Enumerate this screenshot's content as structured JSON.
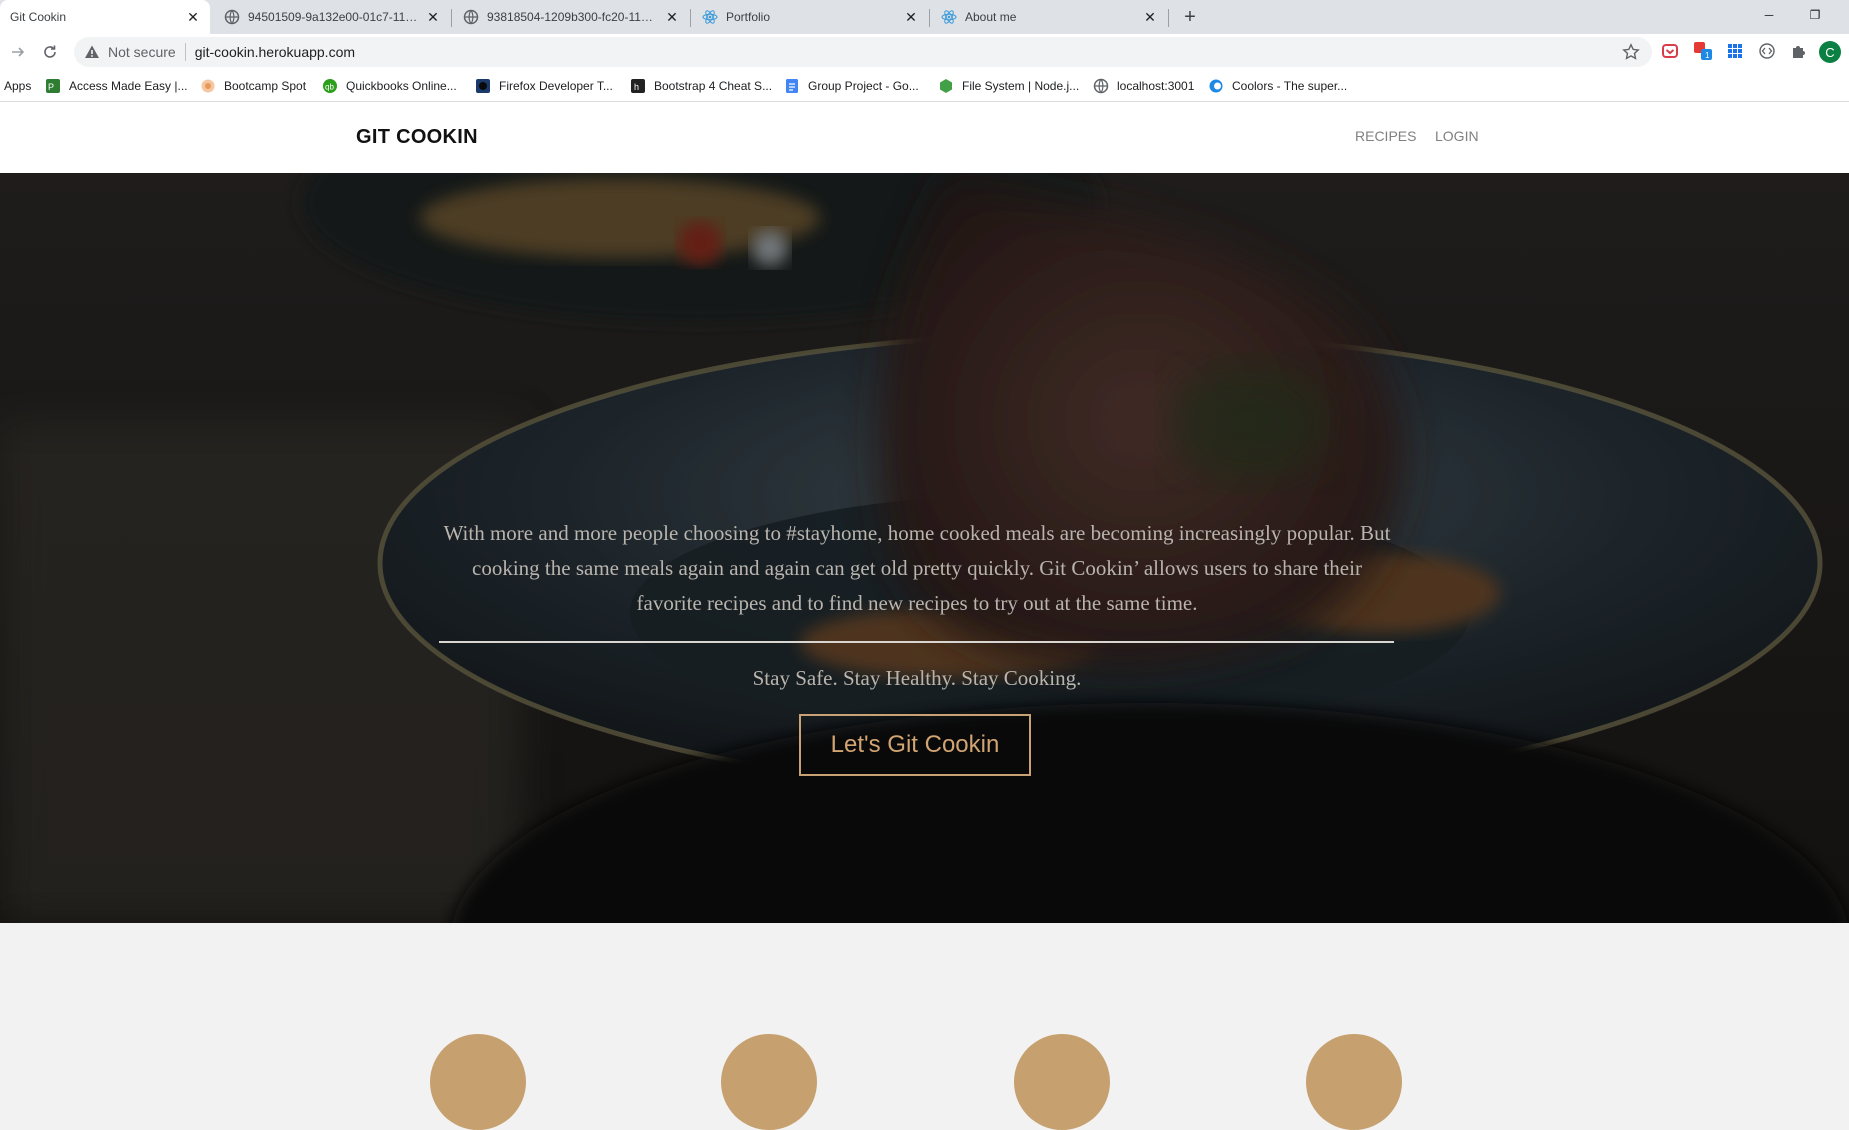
{
  "browser": {
    "tabs": [
      {
        "title": "Git Cookin",
        "icon": "page-icon",
        "active": true
      },
      {
        "title": "94501509-9a132e00-01c7-11eb-",
        "icon": "globe-icon",
        "active": false
      },
      {
        "title": "93818504-1209b300-fc20-11ea-",
        "icon": "globe-icon",
        "active": false
      },
      {
        "title": "Portfolio",
        "icon": "react-icon",
        "active": false
      },
      {
        "title": "About me",
        "icon": "react-icon",
        "active": false
      }
    ],
    "new_tab_glyph": "+",
    "window_controls": {
      "minimize": "─",
      "restore": "❐"
    },
    "security_label": "Not secure",
    "url": "git-cookin.herokuapp.com",
    "profile_initial": "C",
    "bookmarks": [
      {
        "label": "Apps",
        "icon": "apps-grid-icon"
      },
      {
        "label": "Access Made Easy |...",
        "icon": "access-icon"
      },
      {
        "label": "Bootcamp Spot",
        "icon": "bootcamp-icon"
      },
      {
        "label": "Quickbooks Online...",
        "icon": "quickbooks-icon"
      },
      {
        "label": "Firefox Developer T...",
        "icon": "firefox-icon"
      },
      {
        "label": "Bootstrap 4 Cheat S...",
        "icon": "hackerthemes-icon"
      },
      {
        "label": "Group Project - Go...",
        "icon": "google-docs-icon"
      },
      {
        "label": "File System | Node.j...",
        "icon": "nodejs-icon"
      },
      {
        "label": "localhost:3001",
        "icon": "globe-icon"
      },
      {
        "label": "Coolors - The super...",
        "icon": "coolors-icon"
      }
    ]
  },
  "site": {
    "brand": "GIT COOKIN",
    "nav": {
      "recipes": "RECIPES",
      "login": "LOGIN"
    },
    "hero": {
      "intro_line1": "With more and more people choosing to #stayhome, home cooked meals are becoming increasingly popular. But",
      "intro_line2": "cooking the same meals again and again can get old pretty quickly. Git Cookin’ allows users to share their",
      "intro_line3": "favorite recipes and to find new recipes to try out at the same time.",
      "tagline": "Stay Safe. Stay Healthy. Stay Cooking.",
      "cta": "Let's Git Cookin"
    }
  },
  "colors": {
    "accent": "#c8a174",
    "hero_text": "#b9b4ad",
    "header_bg": "#ffffff",
    "section_bg": "#f2f2f2"
  }
}
